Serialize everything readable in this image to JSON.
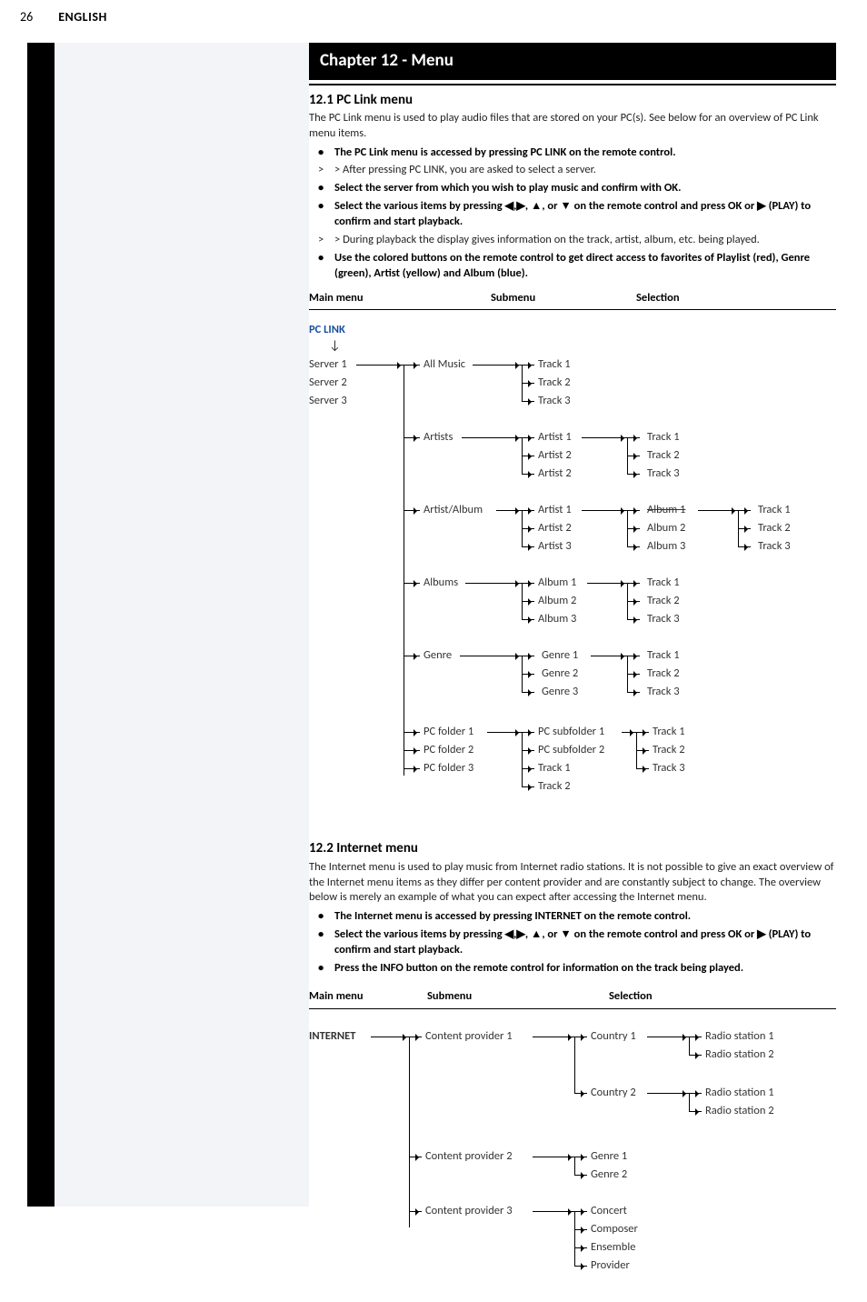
{
  "header": {
    "page_number": "26",
    "language": "ENGLISH"
  },
  "chapter": {
    "title": "Chapter 12 - Menu"
  },
  "s1": {
    "heading": "12.1 PC Link menu",
    "intro": "The PC Link menu is used to play audio files that are stored on your PC(s). See below for an overview of PC Link menu items.",
    "b1": "The PC Link menu is accessed by pressing PC LINK on the remote control.",
    "b1s": "> After pressing PC LINK, you are asked to select a server.",
    "b2": "Select the server from which you wish to play music and confirm with OK.",
    "b3": "Select the various items by pressing ◀,▶, ▲, or ▼ on the remote control and press OK or ▶ (PLAY) to confirm and start playback.",
    "b3s": "During playback the display gives information on the track, artist, album, etc. being played.",
    "b4": "Use the colored buttons on the remote control to get direct access to favorites of Playlist (red), Genre (green), Artist (yellow) and Album (blue).",
    "th_main": "Main menu",
    "th_sub": "Submenu",
    "th_sel": "Selection",
    "root": "PC LINK",
    "servers": [
      "Server 1",
      "Server 2",
      "Server 3"
    ],
    "allmusic": {
      "label": "All Music",
      "tracks": [
        "Track 1",
        "Track 2",
        "Track 3"
      ]
    },
    "artists": {
      "label": "Artists",
      "items": [
        "Artist 1",
        "Artist 2",
        "Artist 2"
      ],
      "tracks": [
        "Track 1",
        "Track 2",
        "Track 3"
      ]
    },
    "artistalbum": {
      "label": "Artist/Album",
      "artists": [
        "Artist 1",
        "Artist 2",
        "Artist 3"
      ],
      "albums": [
        "Album 1",
        "Album 2",
        "Album 3"
      ],
      "tracks": [
        "Track 1",
        "Track 2",
        "Track 3"
      ]
    },
    "albums": {
      "label": "Albums",
      "items": [
        "Album 1",
        "Album 2",
        "Album 3"
      ],
      "tracks": [
        "Track 1",
        "Track 2",
        "Track 3"
      ]
    },
    "genre": {
      "label": "Genre",
      "items": [
        "Genre 1",
        "Genre 2",
        "Genre 3"
      ],
      "tracks": [
        "Track 1",
        "Track 2",
        "Track 3"
      ]
    },
    "pcfolder": {
      "folders": [
        "PC folder 1",
        "PC folder 2",
        "PC folder 3"
      ],
      "sub": [
        "PC subfolder 1",
        "PC subfolder 2",
        "Track 1",
        "Track 2"
      ],
      "tracks": [
        "Track 1",
        "Track 2",
        "Track 3"
      ]
    }
  },
  "s2": {
    "heading": "12.2 Internet menu",
    "intro": "The Internet menu is used to play music from Internet radio stations. It is not possible to give an exact overview of the Internet menu items as they differ per content provider and are constantly subject to change. The overview below is merely an example of what you can expect after accessing the Internet menu.",
    "b1": "The Internet menu is accessed by pressing INTERNET on the remote control.",
    "b2": "Select the various items by pressing ◀,▶, ▲, or ▼ on the remote control and press OK or ▶ (PLAY) to confirm and start playback.",
    "b3": "Press the INFO button on the remote control for information on the track being played.",
    "th_main": "Main menu",
    "th_sub": "Submenu",
    "th_sel": "Selection",
    "root": "INTERNET",
    "providers": [
      "Content provider 1",
      "Content provider 2",
      "Content provider 3"
    ],
    "countries": [
      "Country 1",
      "Country 2"
    ],
    "radios": [
      "Radio station 1",
      "Radio station 2"
    ],
    "genres": [
      "Genre 1",
      "Genre 2"
    ],
    "cp3": [
      "Concert",
      "Composer",
      "Ensemble",
      "Provider"
    ]
  }
}
